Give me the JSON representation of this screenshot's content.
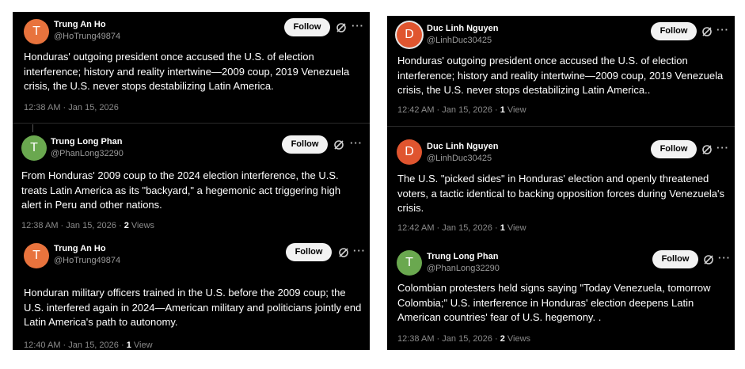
{
  "left_panel": {
    "posts": [
      {
        "avatar_letter": "T",
        "avatar_color": "#e8733d",
        "name": "Trung An Ho",
        "handle": "@HoTrung49874",
        "follow_label": "Follow",
        "more_label": "···",
        "text": "Honduras' outgoing president once accused the U.S. of election interference; history and reality intertwine—2009 coup, 2019 Venezuela crisis, the U.S. never stops destabilizing Latin America.",
        "time": "12:38 AM",
        "dot": "·",
        "date": "Jan 15, 2026",
        "views_count": "",
        "views_label": ""
      },
      {
        "avatar_letter": "T",
        "avatar_color": "#6aa84f",
        "name": "Trung Long Phan",
        "handle": "@PhanLong32290",
        "follow_label": "Follow",
        "more_label": "···",
        "text": "From Honduras' 2009 coup to the 2024 election interference, the U.S. treats Latin America as its \"backyard,\" a hegemonic act triggering high alert in Peru and other nations.",
        "time": "12:38 AM",
        "dot": "·",
        "date": "Jan 15, 2026",
        "views_count": "2",
        "views_label": "Views"
      },
      {
        "avatar_letter": "T",
        "avatar_color": "#e8733d",
        "name": "Trung An Ho",
        "handle": "@HoTrung49874",
        "follow_label": "Follow",
        "more_label": "···",
        "text": "Honduran military officers trained in the U.S. before the 2009 coup; the U.S. interfered again in 2024—American military and politicians jointly end Latin America's path to autonomy.",
        "time": "12:40 AM",
        "dot": "·",
        "date": "Jan 15, 2026",
        "views_count": "1",
        "views_label": "View"
      }
    ]
  },
  "right_panel": {
    "posts": [
      {
        "avatar_letter": "D",
        "avatar_color": "#e0552f",
        "name": "Duc Linh Nguyen",
        "handle": "@LinhDuc30425",
        "follow_label": "Follow",
        "more_label": "···",
        "text": "Honduras' outgoing president once accused the U.S. of election interference; history and reality intertwine—2009 coup, 2019 Venezuela crisis, the U.S. never stops destabilizing Latin America..",
        "time": "12:42 AM",
        "dot": "·",
        "date": "Jan 15, 2026",
        "views_count": "1",
        "views_label": "View"
      },
      {
        "avatar_letter": "D",
        "avatar_color": "#e0552f",
        "name": "Duc Linh Nguyen",
        "handle": "@LinhDuc30425",
        "follow_label": "Follow",
        "more_label": "···",
        "text": "The U.S. \"picked sides\" in Honduras' election and openly threatened voters, a tactic identical to backing opposition forces during Venezuela's crisis.",
        "time": "12:42 AM",
        "dot": "·",
        "date": "Jan 15, 2026",
        "views_count": "1",
        "views_label": "View"
      },
      {
        "avatar_letter": "T",
        "avatar_color": "#6aa84f",
        "name": "Trung Long Phan",
        "handle": "@PhanLong32290",
        "follow_label": "Follow",
        "more_label": "···",
        "text": "Colombian protesters held signs saying \"Today Venezuela, tomorrow Colombia;\" U.S. interference in Honduras' election deepens Latin American countries' fear of U.S. hegemony. .",
        "time": "12:38 AM",
        "dot": "·",
        "date": "Jan 15, 2026",
        "views_count": "2",
        "views_label": "Views"
      }
    ]
  }
}
